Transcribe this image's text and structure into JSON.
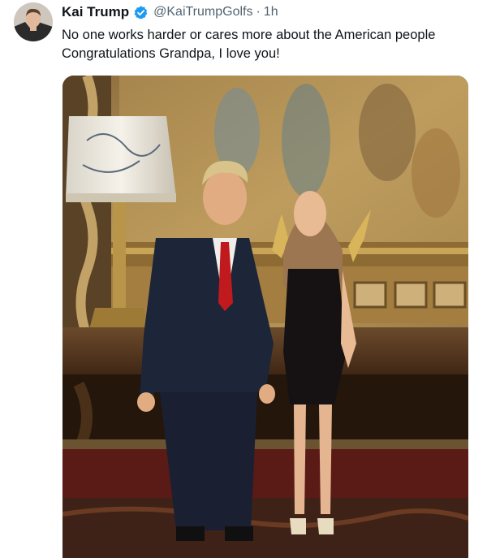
{
  "tweet": {
    "author_name": "Kai Trump",
    "handle": "@KaiTrumpGolfs",
    "separator": "·",
    "time": "1h",
    "verified_icon": "verified-badge-icon",
    "text_line1": "No one works harder or cares more about the American people",
    "text_line2": "Congratulations Grandpa, I love you!",
    "colors": {
      "verified": "#1d9bf0",
      "text": "#0f1419",
      "muted": "#536471"
    }
  }
}
